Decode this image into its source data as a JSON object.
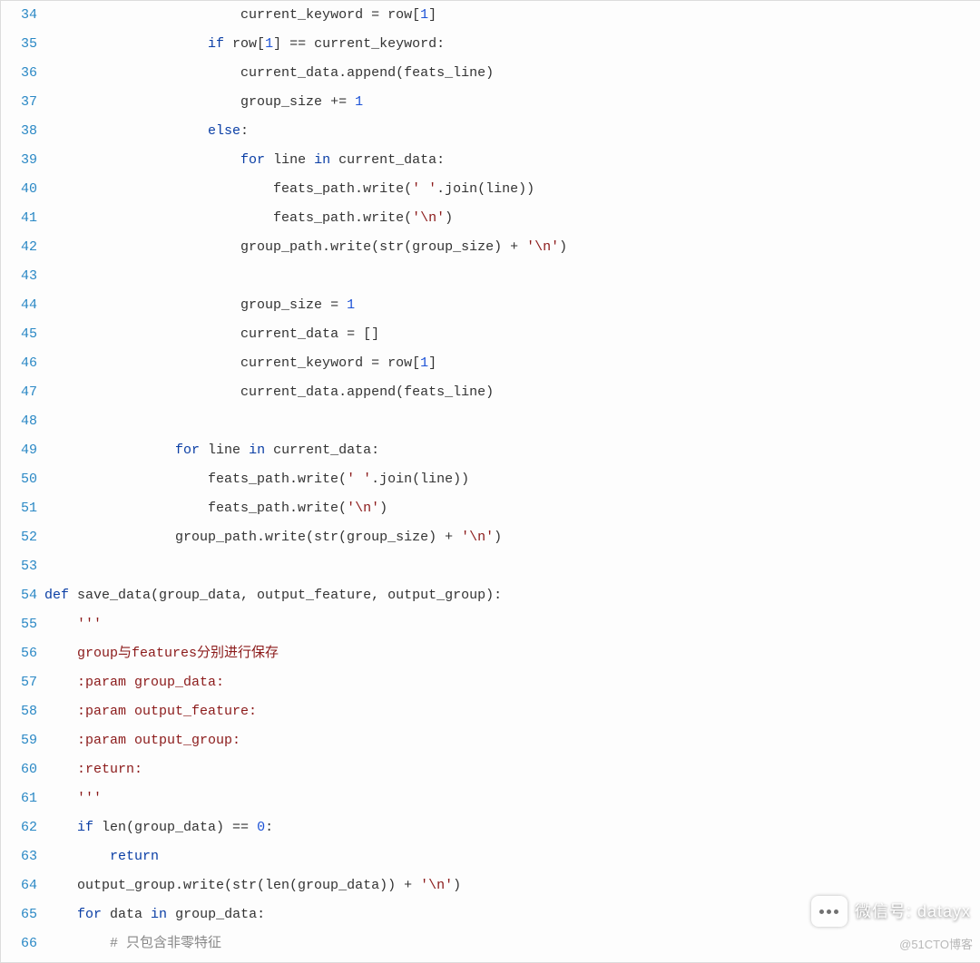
{
  "lines": [
    {
      "n": 34,
      "tokens": [
        [
          "sp",
          "                        "
        ],
        [
          "id",
          "current_keyword = row["
        ],
        [
          "num",
          "1"
        ],
        [
          "id",
          "]"
        ]
      ]
    },
    {
      "n": 35,
      "tokens": [
        [
          "sp",
          "                    "
        ],
        [
          "kw",
          "if"
        ],
        [
          "id",
          " row["
        ],
        [
          "num",
          "1"
        ],
        [
          "id",
          "] == current_keyword:"
        ]
      ]
    },
    {
      "n": 36,
      "tokens": [
        [
          "sp",
          "                        "
        ],
        [
          "id",
          "current_data.append(feats_line)"
        ]
      ]
    },
    {
      "n": 37,
      "tokens": [
        [
          "sp",
          "                        "
        ],
        [
          "id",
          "group_size += "
        ],
        [
          "num",
          "1"
        ]
      ]
    },
    {
      "n": 38,
      "tokens": [
        [
          "sp",
          "                    "
        ],
        [
          "kw",
          "else"
        ],
        [
          "id",
          ":"
        ]
      ]
    },
    {
      "n": 39,
      "tokens": [
        [
          "sp",
          "                        "
        ],
        [
          "kw",
          "for"
        ],
        [
          "id",
          " line "
        ],
        [
          "kw",
          "in"
        ],
        [
          "id",
          " current_data:"
        ]
      ]
    },
    {
      "n": 40,
      "tokens": [
        [
          "sp",
          "                            "
        ],
        [
          "id",
          "feats_path.write("
        ],
        [
          "str",
          "' '"
        ],
        [
          "id",
          ".join(line))"
        ]
      ]
    },
    {
      "n": 41,
      "tokens": [
        [
          "sp",
          "                            "
        ],
        [
          "id",
          "feats_path.write("
        ],
        [
          "str",
          "'\\n'"
        ],
        [
          "id",
          ")"
        ]
      ]
    },
    {
      "n": 42,
      "tokens": [
        [
          "sp",
          "                        "
        ],
        [
          "id",
          "group_path.write(str(group_size) + "
        ],
        [
          "str",
          "'\\n'"
        ],
        [
          "id",
          ")"
        ]
      ]
    },
    {
      "n": 43,
      "tokens": []
    },
    {
      "n": 44,
      "tokens": [
        [
          "sp",
          "                        "
        ],
        [
          "id",
          "group_size = "
        ],
        [
          "num",
          "1"
        ]
      ]
    },
    {
      "n": 45,
      "tokens": [
        [
          "sp",
          "                        "
        ],
        [
          "id",
          "current_data = []"
        ]
      ]
    },
    {
      "n": 46,
      "tokens": [
        [
          "sp",
          "                        "
        ],
        [
          "id",
          "current_keyword = row["
        ],
        [
          "num",
          "1"
        ],
        [
          "id",
          "]"
        ]
      ]
    },
    {
      "n": 47,
      "tokens": [
        [
          "sp",
          "                        "
        ],
        [
          "id",
          "current_data.append(feats_line)"
        ]
      ]
    },
    {
      "n": 48,
      "tokens": []
    },
    {
      "n": 49,
      "tokens": [
        [
          "sp",
          "                "
        ],
        [
          "kw",
          "for"
        ],
        [
          "id",
          " line "
        ],
        [
          "kw",
          "in"
        ],
        [
          "id",
          " current_data:"
        ]
      ]
    },
    {
      "n": 50,
      "tokens": [
        [
          "sp",
          "                    "
        ],
        [
          "id",
          "feats_path.write("
        ],
        [
          "str",
          "' '"
        ],
        [
          "id",
          ".join(line))"
        ]
      ]
    },
    {
      "n": 51,
      "tokens": [
        [
          "sp",
          "                    "
        ],
        [
          "id",
          "feats_path.write("
        ],
        [
          "str",
          "'\\n'"
        ],
        [
          "id",
          ")"
        ]
      ]
    },
    {
      "n": 52,
      "tokens": [
        [
          "sp",
          "                "
        ],
        [
          "id",
          "group_path.write(str(group_size) + "
        ],
        [
          "str",
          "'\\n'"
        ],
        [
          "id",
          ")"
        ]
      ]
    },
    {
      "n": 53,
      "tokens": []
    },
    {
      "n": 54,
      "tokens": [
        [
          "kw",
          "def"
        ],
        [
          "id",
          " save_data(group_data, output_feature, output_group):"
        ]
      ]
    },
    {
      "n": 55,
      "tokens": [
        [
          "sp",
          "    "
        ],
        [
          "doc",
          "'''"
        ]
      ]
    },
    {
      "n": 56,
      "tokens": [
        [
          "sp",
          "    "
        ],
        [
          "doc",
          "group与features分别进行保存"
        ]
      ]
    },
    {
      "n": 57,
      "tokens": [
        [
          "sp",
          "    "
        ],
        [
          "doc",
          ":param group_data:"
        ]
      ]
    },
    {
      "n": 58,
      "tokens": [
        [
          "sp",
          "    "
        ],
        [
          "doc",
          ":param output_feature:"
        ]
      ]
    },
    {
      "n": 59,
      "tokens": [
        [
          "sp",
          "    "
        ],
        [
          "doc",
          ":param output_group:"
        ]
      ]
    },
    {
      "n": 60,
      "tokens": [
        [
          "sp",
          "    "
        ],
        [
          "doc",
          ":return:"
        ]
      ]
    },
    {
      "n": 61,
      "tokens": [
        [
          "sp",
          "    "
        ],
        [
          "doc",
          "'''"
        ]
      ]
    },
    {
      "n": 62,
      "tokens": [
        [
          "sp",
          "    "
        ],
        [
          "kw",
          "if"
        ],
        [
          "id",
          " len(group_data) == "
        ],
        [
          "num",
          "0"
        ],
        [
          "id",
          ":"
        ]
      ]
    },
    {
      "n": 63,
      "tokens": [
        [
          "sp",
          "        "
        ],
        [
          "kw",
          "return"
        ]
      ]
    },
    {
      "n": 64,
      "tokens": [
        [
          "sp",
          "    "
        ],
        [
          "id",
          "output_group.write(str(len(group_data)) + "
        ],
        [
          "str",
          "'\\n'"
        ],
        [
          "id",
          ")"
        ]
      ]
    },
    {
      "n": 65,
      "tokens": [
        [
          "sp",
          "    "
        ],
        [
          "kw",
          "for"
        ],
        [
          "id",
          " data "
        ],
        [
          "kw",
          "in"
        ],
        [
          "id",
          " group_data:"
        ]
      ]
    },
    {
      "n": 66,
      "tokens": [
        [
          "sp",
          "        "
        ],
        [
          "cmt",
          "# 只包含非零特征"
        ]
      ]
    }
  ],
  "badge": {
    "label": "微信号",
    "value": "datayx"
  },
  "watermark": "@51CTO博客"
}
